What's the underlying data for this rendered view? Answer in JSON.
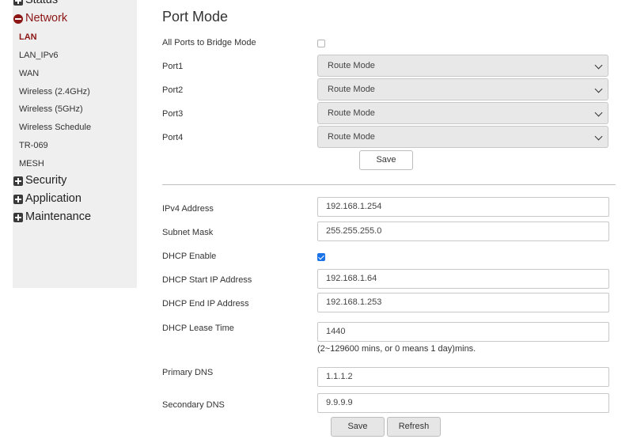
{
  "sidebar": {
    "status": "Status",
    "network": "Network",
    "network_items": [
      "LAN",
      "LAN_IPv6",
      "WAN",
      "Wireless (2.4GHz)",
      "Wireless (5GHz)",
      "Wireless Schedule",
      "TR-069",
      "MESH"
    ],
    "active_item": "LAN",
    "security": "Security",
    "application": "Application",
    "maintenance": "Maintenance"
  },
  "port_mode": {
    "title": "Port Mode",
    "bridge_label": "All Ports to Bridge Mode",
    "bridge_checked": false,
    "ports": [
      {
        "label": "Port1",
        "value": "Route Mode"
      },
      {
        "label": "Port2",
        "value": "Route Mode"
      },
      {
        "label": "Port3",
        "value": "Route Mode"
      },
      {
        "label": "Port4",
        "value": "Route Mode"
      }
    ],
    "save_label": "Save"
  },
  "lan": {
    "ipv4_label": "IPv4 Address",
    "ipv4_value": "192.168.1.254",
    "mask_label": "Subnet Mask",
    "mask_value": "255.255.255.0",
    "dhcp_label": "DHCP Enable",
    "dhcp_checked": true,
    "start_label": "DHCP Start IP Address",
    "start_value": "192.168.1.64",
    "end_label": "DHCP End IP Address",
    "end_value": "192.168.1.253",
    "lease_label": "DHCP Lease Time",
    "lease_value": "1440",
    "lease_hint": "(2~129600 mins, or 0 means 1 day)mins.",
    "dns1_label": "Primary DNS",
    "dns1_value": "1.1.1.2",
    "dns2_label": "Secondary DNS",
    "dns2_value": "9.9.9.9",
    "save_label": "Save",
    "refresh_label": "Refresh"
  },
  "colors": {
    "accent": "#8c1515",
    "checkbox": "#1a73e8",
    "sidebar_bg": "#efefef"
  }
}
